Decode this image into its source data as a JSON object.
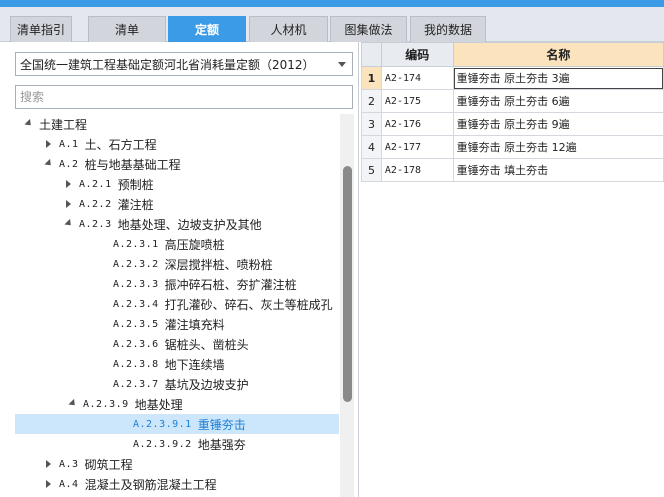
{
  "tabs": [
    {
      "label": "清单指引",
      "active": false
    },
    {
      "label": "清单",
      "active": false
    },
    {
      "label": "定额",
      "active": true
    },
    {
      "label": "人材机",
      "active": false
    },
    {
      "label": "图集做法",
      "active": false
    },
    {
      "label": "我的数据",
      "active": false
    }
  ],
  "quota_select": {
    "value": "全国统一建筑工程基础定额河北省消耗量定额（2012）"
  },
  "search": {
    "placeholder": "搜索",
    "value": ""
  },
  "tree": [
    {
      "code": "",
      "label": "土建工程",
      "state": "expanded",
      "level": 0
    },
    {
      "code": "A.1",
      "label": "土、石方工程",
      "state": "collapsed",
      "level": 1
    },
    {
      "code": "A.2",
      "label": "桩与地基基础工程",
      "state": "expanded",
      "level": 1
    },
    {
      "code": "A.2.1",
      "label": "预制桩",
      "state": "collapsed",
      "level": 2
    },
    {
      "code": "A.2.2",
      "label": "灌注桩",
      "state": "collapsed",
      "level": 2
    },
    {
      "code": "A.2.3",
      "label": "地基处理、边坡支护及其他",
      "state": "expanded",
      "level": 2
    },
    {
      "code": "A.2.3.1",
      "label": "高压旋喷桩",
      "state": "leaf",
      "level": 3
    },
    {
      "code": "A.2.3.2",
      "label": "深层搅拌桩、喷粉桩",
      "state": "leaf",
      "level": 3
    },
    {
      "code": "A.2.3.3",
      "label": "振冲碎石桩、夯扩灌注桩",
      "state": "leaf",
      "level": 3
    },
    {
      "code": "A.2.3.4",
      "label": "打孔灌砂、碎石、灰土等桩成孔",
      "state": "leaf",
      "level": 3
    },
    {
      "code": "A.2.3.5",
      "label": "灌注填充料",
      "state": "leaf",
      "level": 3
    },
    {
      "code": "A.2.3.6",
      "label": "锯桩头、凿桩头",
      "state": "leaf",
      "level": 3
    },
    {
      "code": "A.2.3.8",
      "label": "地下连续墙",
      "state": "leaf",
      "level": 3
    },
    {
      "code": "A.2.3.7",
      "label": "基坑及边坡支护",
      "state": "leaf",
      "level": 3
    },
    {
      "code": "A.2.3.9",
      "label": "地基处理",
      "state": "expanded",
      "level": 3,
      "leftOffset": -16
    },
    {
      "code": "A.2.3.9.1",
      "label": "重锤夯击",
      "state": "leaf",
      "level": 4,
      "selected": true
    },
    {
      "code": "A.2.3.9.2",
      "label": "地基强夯",
      "state": "leaf",
      "level": 4
    },
    {
      "code": "A.3",
      "label": "砌筑工程",
      "state": "collapsed",
      "level": 1
    },
    {
      "code": "A.4",
      "label": "混凝土及钢筋混凝土工程",
      "state": "collapsed",
      "level": 1
    }
  ],
  "table": {
    "headers": {
      "code": "编码",
      "name": "名称"
    },
    "rows": [
      {
        "num": "1",
        "code": "A2-174",
        "name": "重锤夯击 原土夯击 3遍",
        "selected": true
      },
      {
        "num": "2",
        "code": "A2-175",
        "name": "重锤夯击 原土夯击 6遍"
      },
      {
        "num": "3",
        "code": "A2-176",
        "name": "重锤夯击 原土夯击 9遍"
      },
      {
        "num": "4",
        "code": "A2-177",
        "name": "重锤夯击 原土夯击 12遍"
      },
      {
        "num": "5",
        "code": "A2-178",
        "name": "重锤夯击 填土夯击"
      }
    ]
  },
  "colors": {
    "accent": "#3c9be6",
    "selected_row_bg": "#cce6fb",
    "header_highlight": "#fbe3bd"
  }
}
